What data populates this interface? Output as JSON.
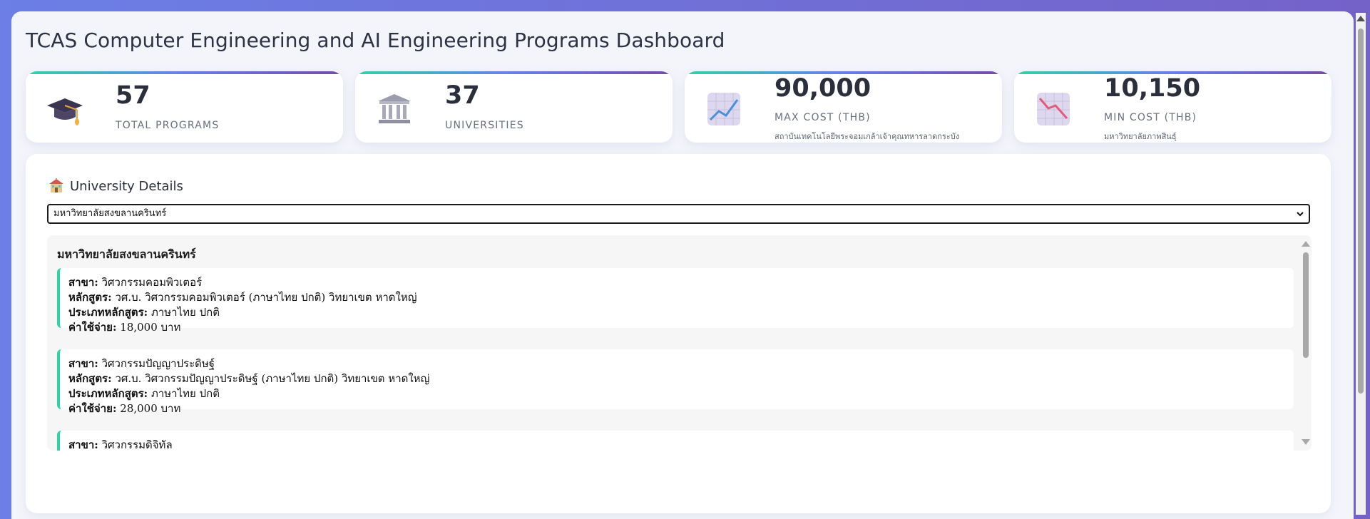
{
  "dashboard": {
    "title": "TCAS Computer Engineering and AI Engineering Programs Dashboard"
  },
  "stats": [
    {
      "icon": "graduation-cap-icon",
      "value": "57",
      "label": "TOTAL PROGRAMS",
      "sub": ""
    },
    {
      "icon": "bank-building-icon",
      "value": "37",
      "label": "UNIVERSITIES",
      "sub": ""
    },
    {
      "icon": "chart-increasing-icon",
      "value": "90,000",
      "label": "MAX COST (THB)",
      "sub": "สถาบันเทคโนโลยีพระจอมเกล้าเจ้าคุณทหารลาดกระบัง"
    },
    {
      "icon": "chart-decreasing-icon",
      "value": "10,150",
      "label": "MIN COST (THB)",
      "sub": "มหาวิทยาลัยภาพสินธุ์"
    }
  ],
  "details": {
    "heading": "University Details",
    "heading_icon": "school-icon",
    "select": {
      "selected": "มหาวิทยาลัยสงขลานครินทร์"
    },
    "university_name": "มหาวิทยาลัยสงขลานครินทร์",
    "field_labels": {
      "major": "สาขา:",
      "program": "หลักสูตร:",
      "type": "ประเภทหลักสูตร:",
      "cost": "ค่าใช้จ่าย:"
    },
    "programs": [
      {
        "major": "วิศวกรรมคอมพิวเตอร์",
        "program": "วศ.บ. วิศวกรรมคอมพิวเตอร์ (ภาษาไทย ปกติ) วิทยาเขต หาดใหญ่",
        "type": "ภาษาไทย ปกติ",
        "cost": "18,000 บาท"
      },
      {
        "major": "วิศวกรรมปัญญาประดิษฐ์",
        "program": "วศ.บ. วิศวกรรมปัญญาประดิษฐ์ (ภาษาไทย ปกติ) วิทยาเขต หาดใหญ่",
        "type": "ภาษาไทย ปกติ",
        "cost": "28,000 บาท"
      },
      {
        "major": "วิศวกรรมดิจิทัล"
      }
    ]
  },
  "colors": {
    "accent_teal": "#2fd3a6",
    "accent_indigo": "#667eea",
    "accent_purple": "#764ba2"
  }
}
